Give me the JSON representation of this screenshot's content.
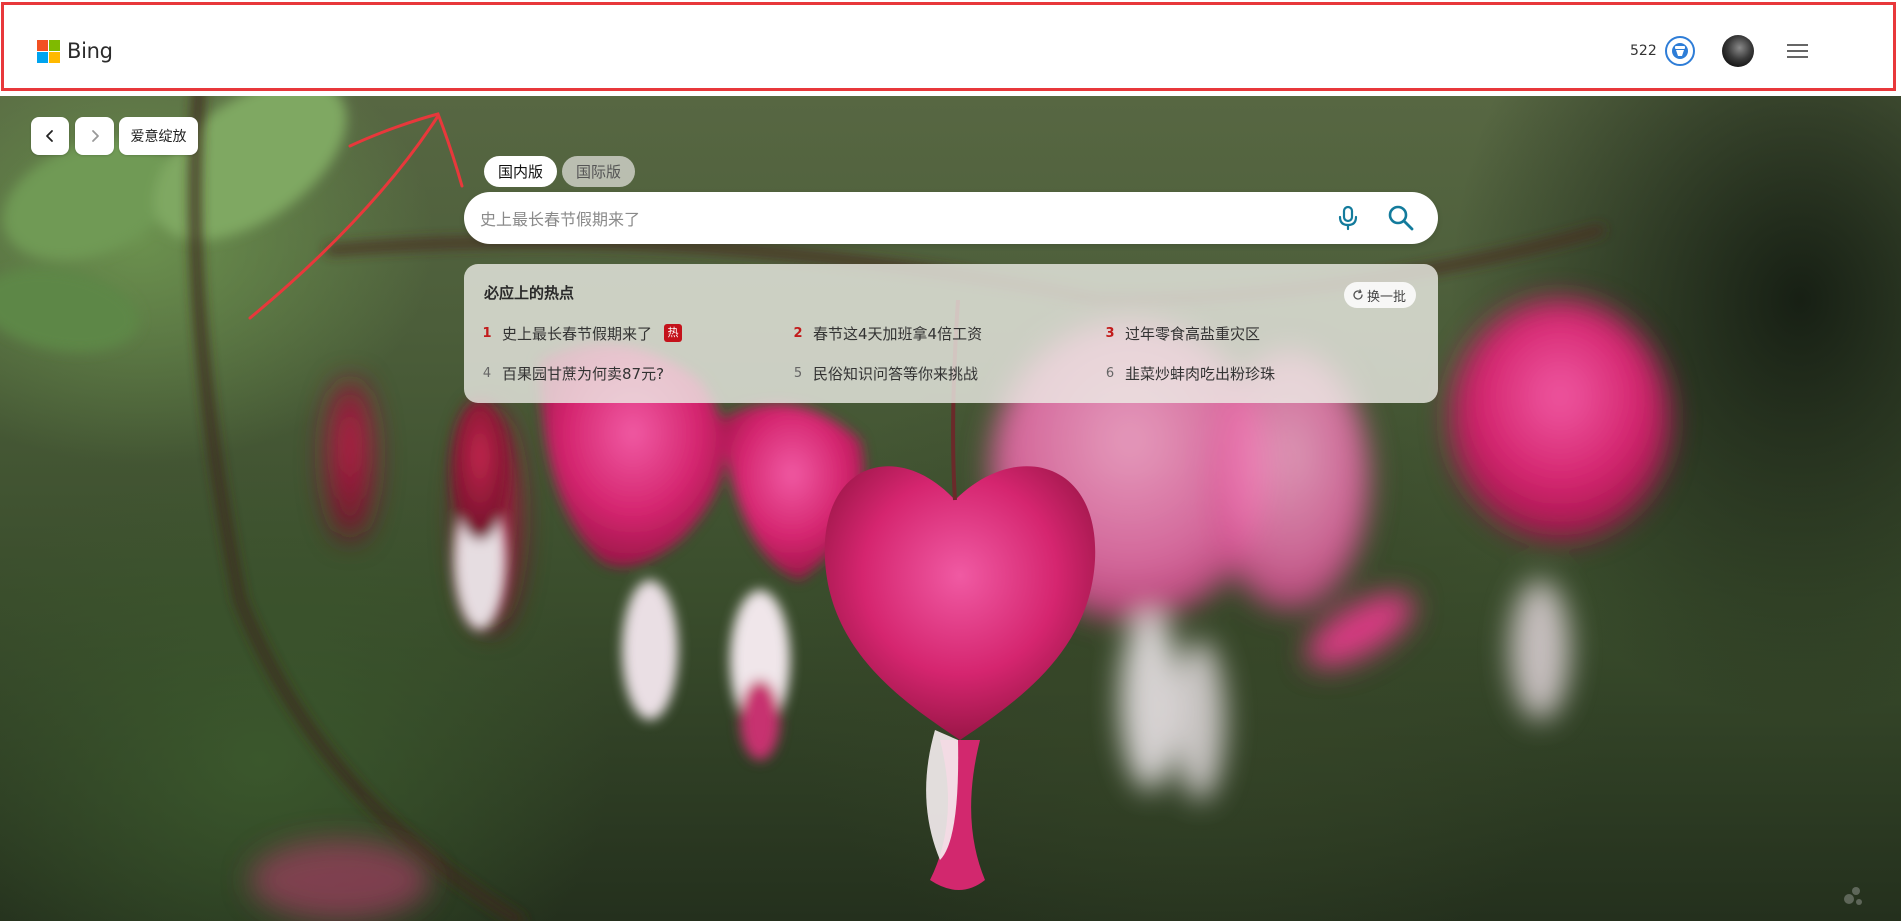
{
  "header": {
    "logo_text": "Bing",
    "logo_colors": [
      "#f25022",
      "#7fba00",
      "#00a4ef",
      "#ffb900"
    ],
    "rewards_points": "522",
    "rewards_icon": "rewards-medal-icon",
    "avatar_icon": "user-avatar",
    "menu_icon": "hamburger-menu-icon",
    "highlight_color": "#e8383b"
  },
  "image_nav": {
    "prev_icon": "chevron-left-icon",
    "next_icon": "chevron-right-icon",
    "caption": "爱意绽放"
  },
  "search": {
    "tabs": [
      {
        "label": "国内版",
        "active": true
      },
      {
        "label": "国际版",
        "active": false
      }
    ],
    "placeholder": "史上最长春节假期来了",
    "mic_icon": "microphone-icon",
    "search_icon": "search-icon",
    "accent_color": "#137b9c"
  },
  "trending": {
    "title": "必应上的热点",
    "refresh_label": "换一批",
    "hot_badge": "热",
    "items": [
      {
        "rank": "1",
        "text": "史上最长春节假期来了",
        "hot": true
      },
      {
        "rank": "2",
        "text": "春节这4天加班拿4倍工资",
        "hot": false
      },
      {
        "rank": "3",
        "text": "过年零食高盐重灾区",
        "hot": false
      },
      {
        "rank": "4",
        "text": "百果园甘蔗为何卖87元?",
        "hot": false
      },
      {
        "rank": "5",
        "text": "民俗知识问答等你来挑战",
        "hot": false
      },
      {
        "rank": "6",
        "text": "韭菜炒蚌肉吃出粉珍珠",
        "hot": false
      }
    ]
  },
  "footer": {
    "feedback_icon": "feedback-icon"
  }
}
